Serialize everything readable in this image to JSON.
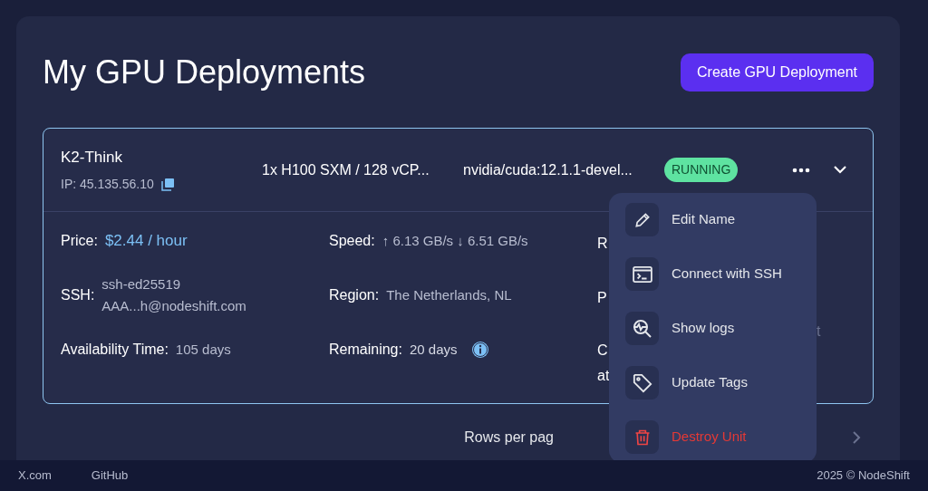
{
  "title": "My GPU Deployments",
  "create_button": "Create GPU Deployment",
  "deployment": {
    "name": "K2-Think",
    "ip": "IP: 45.135.56.10",
    "spec": "1x H100 SXM / 128 vCP...",
    "image": "nvidia/cuda:12.1.1-devel...",
    "status": "RUNNING",
    "expanded": true,
    "details": [
      {
        "label": "Price:",
        "value": "$2.44 / hour",
        "kind": "price"
      },
      {
        "label": "Speed:",
        "value": "↑ 6.13 GB/s ↓ 6.51 GB/s",
        "kind": "plain"
      },
      {
        "label": "SSH:",
        "lines": [
          "ssh-ed25519",
          "AAA...h@nodeshift.com"
        ],
        "kind": "multi"
      },
      {
        "label": "Region:",
        "value": "The Netherlands, NL",
        "kind": "plain"
      },
      {
        "label": "Availability Time:",
        "value": "105 days",
        "kind": "plain"
      },
      {
        "label": "Remaining:",
        "value": "20 days",
        "kind": "info"
      }
    ],
    "covered_fragments": [
      "R",
      "P",
      "C",
      "at"
    ],
    "covered_tail": "t"
  },
  "menu": [
    {
      "label": "Edit Name",
      "kind": "edit"
    },
    {
      "label": "Connect with SSH",
      "kind": "terminal"
    },
    {
      "label": "Show logs",
      "kind": "logs"
    },
    {
      "label": "Update Tags",
      "kind": "tag"
    },
    {
      "label": "Destroy Unit",
      "kind": "danger"
    }
  ],
  "pagination": {
    "rows_label": "Rows per pag"
  },
  "footer": {
    "links": [
      "X.com",
      "GitHub"
    ],
    "copyright": "2025 © NodeShift"
  }
}
